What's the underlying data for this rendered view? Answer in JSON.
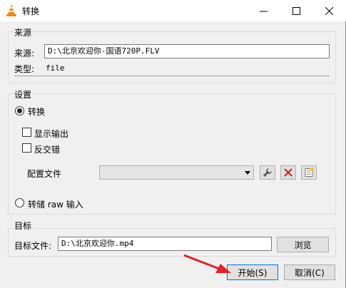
{
  "window": {
    "title": "转换",
    "controls": {
      "minimize": "—",
      "maximize": "☐",
      "close": "✕"
    }
  },
  "source": {
    "group_title": "来源",
    "source_label": "来源:",
    "source_value": "D:\\北京欢迎你-国语720P.FLV",
    "type_label": "类型:",
    "type_value": "file"
  },
  "settings": {
    "group_title": "设置",
    "convert_label": "转换",
    "show_output_label": "显示输出",
    "deinterlace_label": "反交错",
    "profile_label": "配置文件",
    "profile_value": "",
    "dump_raw_label": "转储 raw 输入"
  },
  "destination": {
    "group_title": "目标",
    "file_label": "目标文件:",
    "file_value": "D:\\北京欢迎你.mp4",
    "browse_label": "浏览"
  },
  "buttons": {
    "start_label": "开始(S)",
    "cancel_label": "取消(C)"
  },
  "colors": {
    "annotation_arrow": "#e8202a",
    "delete_icon": "#d32020",
    "default_button_border": "#0078d7"
  }
}
